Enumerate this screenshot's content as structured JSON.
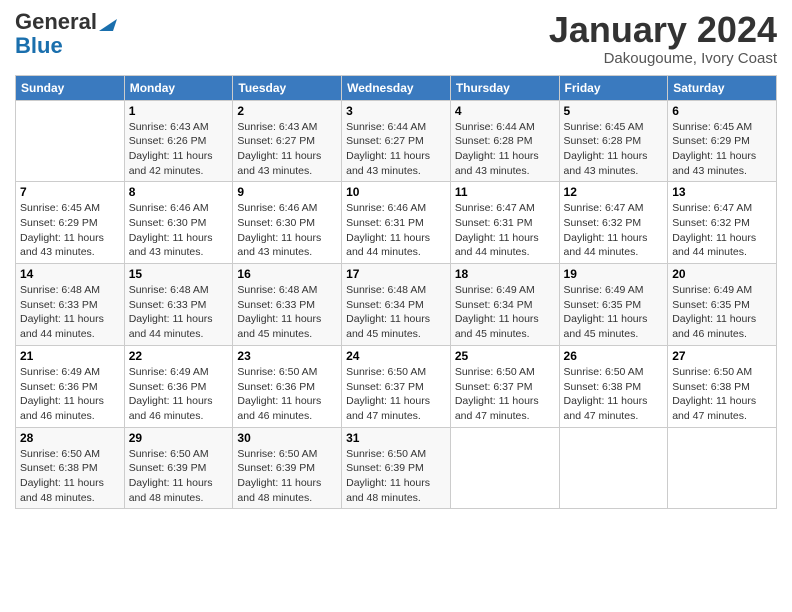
{
  "header": {
    "logo_line1": "General",
    "logo_line2": "Blue",
    "month_title": "January 2024",
    "location": "Dakougoume, Ivory Coast"
  },
  "days_of_week": [
    "Sunday",
    "Monday",
    "Tuesday",
    "Wednesday",
    "Thursday",
    "Friday",
    "Saturday"
  ],
  "weeks": [
    [
      {
        "day": "",
        "info": ""
      },
      {
        "day": "1",
        "info": "Sunrise: 6:43 AM\nSunset: 6:26 PM\nDaylight: 11 hours\nand 42 minutes."
      },
      {
        "day": "2",
        "info": "Sunrise: 6:43 AM\nSunset: 6:27 PM\nDaylight: 11 hours\nand 43 minutes."
      },
      {
        "day": "3",
        "info": "Sunrise: 6:44 AM\nSunset: 6:27 PM\nDaylight: 11 hours\nand 43 minutes."
      },
      {
        "day": "4",
        "info": "Sunrise: 6:44 AM\nSunset: 6:28 PM\nDaylight: 11 hours\nand 43 minutes."
      },
      {
        "day": "5",
        "info": "Sunrise: 6:45 AM\nSunset: 6:28 PM\nDaylight: 11 hours\nand 43 minutes."
      },
      {
        "day": "6",
        "info": "Sunrise: 6:45 AM\nSunset: 6:29 PM\nDaylight: 11 hours\nand 43 minutes."
      }
    ],
    [
      {
        "day": "7",
        "info": "Sunrise: 6:45 AM\nSunset: 6:29 PM\nDaylight: 11 hours\nand 43 minutes."
      },
      {
        "day": "8",
        "info": "Sunrise: 6:46 AM\nSunset: 6:30 PM\nDaylight: 11 hours\nand 43 minutes."
      },
      {
        "day": "9",
        "info": "Sunrise: 6:46 AM\nSunset: 6:30 PM\nDaylight: 11 hours\nand 43 minutes."
      },
      {
        "day": "10",
        "info": "Sunrise: 6:46 AM\nSunset: 6:31 PM\nDaylight: 11 hours\nand 44 minutes."
      },
      {
        "day": "11",
        "info": "Sunrise: 6:47 AM\nSunset: 6:31 PM\nDaylight: 11 hours\nand 44 minutes."
      },
      {
        "day": "12",
        "info": "Sunrise: 6:47 AM\nSunset: 6:32 PM\nDaylight: 11 hours\nand 44 minutes."
      },
      {
        "day": "13",
        "info": "Sunrise: 6:47 AM\nSunset: 6:32 PM\nDaylight: 11 hours\nand 44 minutes."
      }
    ],
    [
      {
        "day": "14",
        "info": "Sunrise: 6:48 AM\nSunset: 6:33 PM\nDaylight: 11 hours\nand 44 minutes."
      },
      {
        "day": "15",
        "info": "Sunrise: 6:48 AM\nSunset: 6:33 PM\nDaylight: 11 hours\nand 44 minutes."
      },
      {
        "day": "16",
        "info": "Sunrise: 6:48 AM\nSunset: 6:33 PM\nDaylight: 11 hours\nand 45 minutes."
      },
      {
        "day": "17",
        "info": "Sunrise: 6:48 AM\nSunset: 6:34 PM\nDaylight: 11 hours\nand 45 minutes."
      },
      {
        "day": "18",
        "info": "Sunrise: 6:49 AM\nSunset: 6:34 PM\nDaylight: 11 hours\nand 45 minutes."
      },
      {
        "day": "19",
        "info": "Sunrise: 6:49 AM\nSunset: 6:35 PM\nDaylight: 11 hours\nand 45 minutes."
      },
      {
        "day": "20",
        "info": "Sunrise: 6:49 AM\nSunset: 6:35 PM\nDaylight: 11 hours\nand 46 minutes."
      }
    ],
    [
      {
        "day": "21",
        "info": "Sunrise: 6:49 AM\nSunset: 6:36 PM\nDaylight: 11 hours\nand 46 minutes."
      },
      {
        "day": "22",
        "info": "Sunrise: 6:49 AM\nSunset: 6:36 PM\nDaylight: 11 hours\nand 46 minutes."
      },
      {
        "day": "23",
        "info": "Sunrise: 6:50 AM\nSunset: 6:36 PM\nDaylight: 11 hours\nand 46 minutes."
      },
      {
        "day": "24",
        "info": "Sunrise: 6:50 AM\nSunset: 6:37 PM\nDaylight: 11 hours\nand 47 minutes."
      },
      {
        "day": "25",
        "info": "Sunrise: 6:50 AM\nSunset: 6:37 PM\nDaylight: 11 hours\nand 47 minutes."
      },
      {
        "day": "26",
        "info": "Sunrise: 6:50 AM\nSunset: 6:38 PM\nDaylight: 11 hours\nand 47 minutes."
      },
      {
        "day": "27",
        "info": "Sunrise: 6:50 AM\nSunset: 6:38 PM\nDaylight: 11 hours\nand 47 minutes."
      }
    ],
    [
      {
        "day": "28",
        "info": "Sunrise: 6:50 AM\nSunset: 6:38 PM\nDaylight: 11 hours\nand 48 minutes."
      },
      {
        "day": "29",
        "info": "Sunrise: 6:50 AM\nSunset: 6:39 PM\nDaylight: 11 hours\nand 48 minutes."
      },
      {
        "day": "30",
        "info": "Sunrise: 6:50 AM\nSunset: 6:39 PM\nDaylight: 11 hours\nand 48 minutes."
      },
      {
        "day": "31",
        "info": "Sunrise: 6:50 AM\nSunset: 6:39 PM\nDaylight: 11 hours\nand 48 minutes."
      },
      {
        "day": "",
        "info": ""
      },
      {
        "day": "",
        "info": ""
      },
      {
        "day": "",
        "info": ""
      }
    ]
  ]
}
